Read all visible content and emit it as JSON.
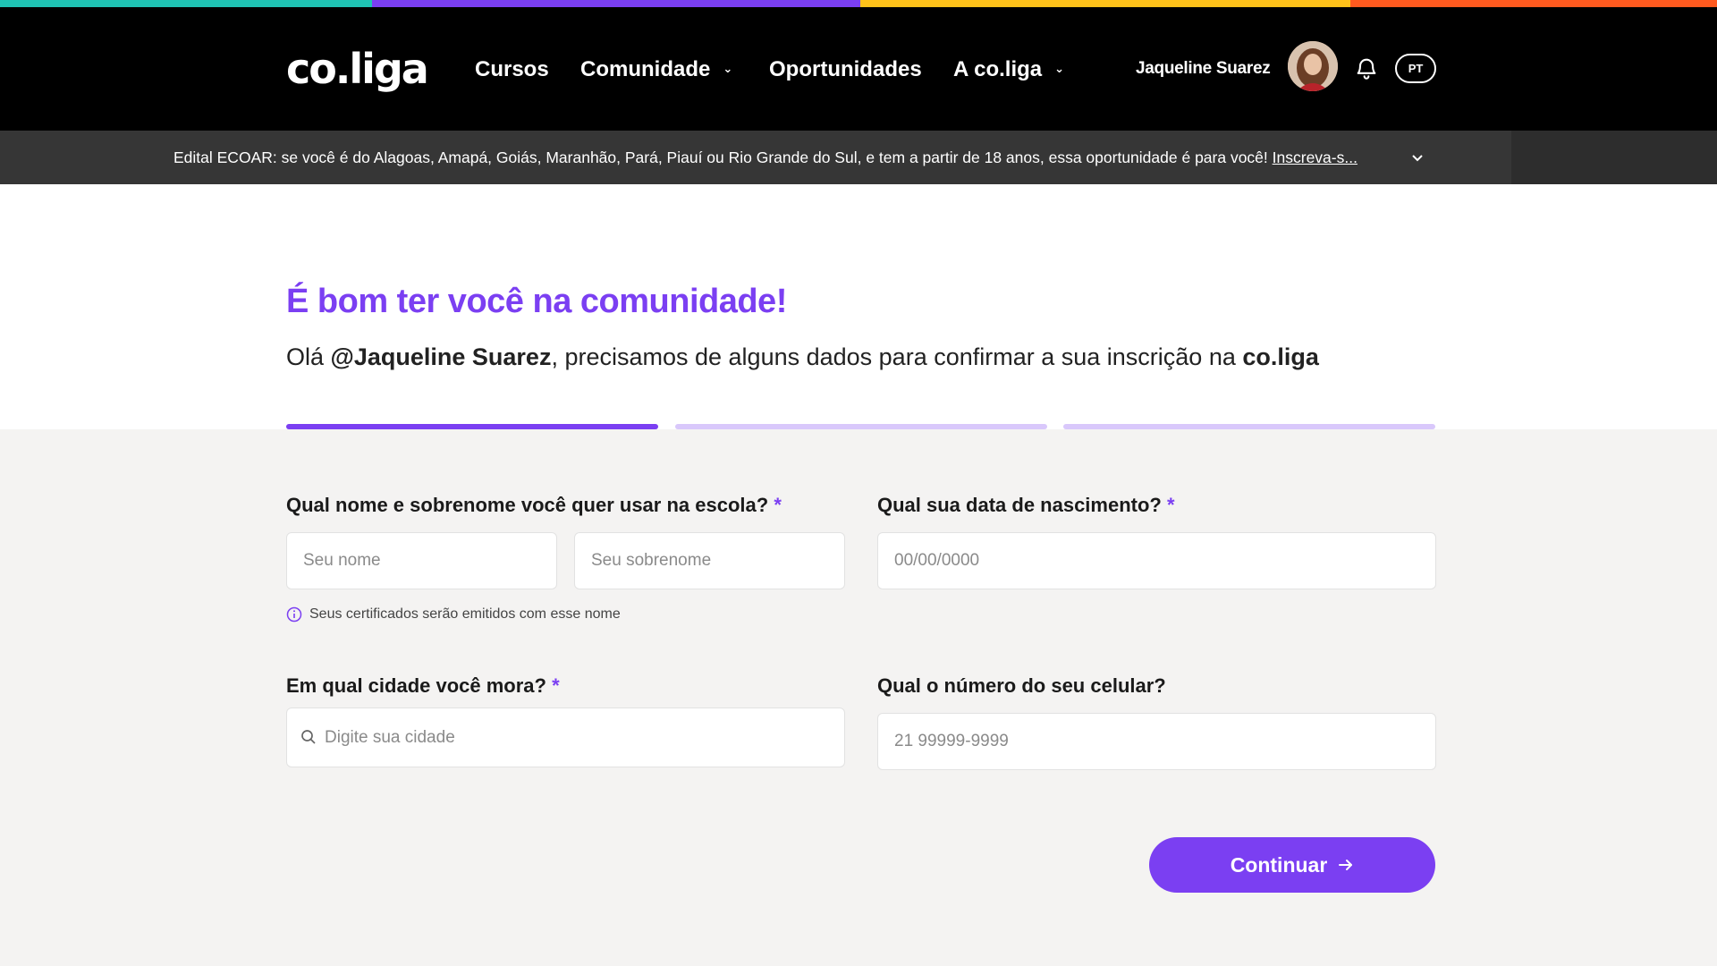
{
  "brand": {
    "logo_text": "co.liga",
    "colors": {
      "bar_teal": "#1fc3b4",
      "bar_purple": "#7b3ff2",
      "bar_yellow": "#ffc21a",
      "bar_orange": "#ff5a1f",
      "accent": "#7b3ff2",
      "accent_light": "#d9c8fb"
    }
  },
  "nav": {
    "items": [
      {
        "label": "Cursos",
        "has_dropdown": false
      },
      {
        "label": "Comunidade",
        "has_dropdown": true
      },
      {
        "label": "Oportunidades",
        "has_dropdown": false
      },
      {
        "label": "A co.liga",
        "has_dropdown": true
      }
    ],
    "user_name": "Jaqueline Suarez",
    "icons": [
      "bell-icon",
      "chevron-down-icon"
    ],
    "language": "PT"
  },
  "banner": {
    "text": "Edital ECOAR: se você é do Alagoas, Amapá, Goiás, Maranhão, Pará, Piauí ou Rio Grande do Sul, e tem a partir de 18 anos, essa oportunidade é para você! ",
    "link": "Inscreva-s..."
  },
  "hero": {
    "title": "É bom ter você na comunidade!",
    "sub_prefix": "Olá ",
    "sub_user": "@Jaqueline Suarez",
    "sub_middle": ", precisamos de alguns dados para confirmar a sua inscrição na ",
    "sub_brand": "co.liga"
  },
  "progress": {
    "total_steps": 3,
    "current_step": 1
  },
  "form": {
    "name_label": "Qual nome e sobrenome você quer usar na escola?",
    "first_name_placeholder": "Seu nome",
    "last_name_placeholder": "Seu sobrenome",
    "name_hint": "Seus certificados serão emitidos com esse nome",
    "birth_label": "Qual sua data de nascimento?",
    "birth_placeholder": "00/00/0000",
    "city_label": "Em qual cidade você mora?",
    "city_placeholder": "Digite sua cidade",
    "phone_label": "Qual o número do seu celular?",
    "phone_placeholder": "21 99999-9999",
    "required_mark": "*",
    "submit_label": "Continuar"
  }
}
